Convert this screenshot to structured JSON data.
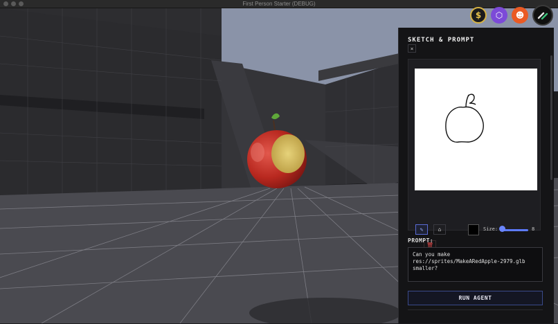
{
  "window": {
    "title": "First Person Starter (DEBUG)"
  },
  "top_icons": [
    {
      "name": "dollar-icon",
      "glyph": "$"
    },
    {
      "name": "cube-icon",
      "glyph": "⬡"
    },
    {
      "name": "reddit-icon",
      "glyph": "☻"
    },
    {
      "name": "app-logo-icon",
      "glyph": ""
    }
  ],
  "panel": {
    "title": "SKETCH & PROMPT",
    "close_glyph": "×",
    "tools": {
      "pen_glyph": "✎",
      "eraser_glyph": "⌂",
      "trash_glyph": "🗑",
      "color": "#000000",
      "size_label": "Size:",
      "size_value": "8",
      "size_level": 8
    },
    "prompt_label": "PROMPT:",
    "prompt_text": "Can you make res://sprites/MakeARedApple-2979.glb smaller?",
    "run_button": "RUN AGENT"
  },
  "colors": {
    "accent": "#5d7bff",
    "panel_bg": "#141416",
    "apple_red": "#c8322b"
  }
}
